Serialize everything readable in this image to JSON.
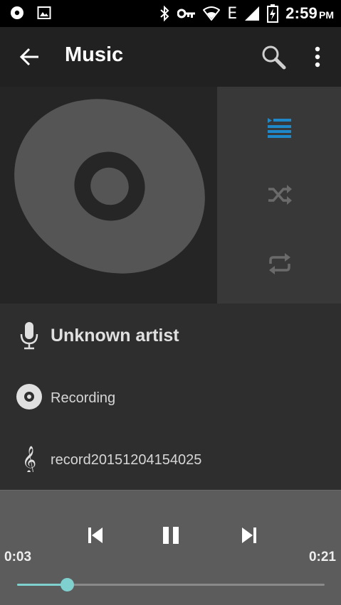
{
  "status_bar": {
    "time": "2:59",
    "ampm": "PM",
    "network_type": "E",
    "icons": [
      "notification-icon",
      "gallery-icon",
      "bluetooth-icon",
      "vpn-key-icon",
      "wifi-icon",
      "signal-icon",
      "battery-charging-icon"
    ]
  },
  "app_bar": {
    "title": "Music",
    "back_icon": "arrow-left-icon",
    "search_icon": "search-icon",
    "more_icon": "more-vert-icon"
  },
  "album_art": {
    "icon": "disc-icon",
    "colors": {
      "background": "#252525",
      "disc": "#555555",
      "ring": "#262626"
    }
  },
  "side_actions": [
    {
      "name": "playlist-button",
      "icon": "playlist-icon",
      "active": true,
      "color": "#1e88c8"
    },
    {
      "name": "shuffle-button",
      "icon": "shuffle-icon",
      "active": false,
      "color": "#6a6a6a"
    },
    {
      "name": "repeat-button",
      "icon": "repeat-icon",
      "active": false,
      "color": "#6a6a6a"
    }
  ],
  "track": {
    "artist": "Unknown artist",
    "album": "Recording",
    "title": "record20151204154025"
  },
  "player": {
    "elapsed": "0:03",
    "duration": "0:21",
    "progress_fraction": 0.163,
    "state": "playing",
    "accent_color": "#7fd1cf",
    "buttons": [
      "previous-icon",
      "pause-icon",
      "next-icon"
    ]
  }
}
